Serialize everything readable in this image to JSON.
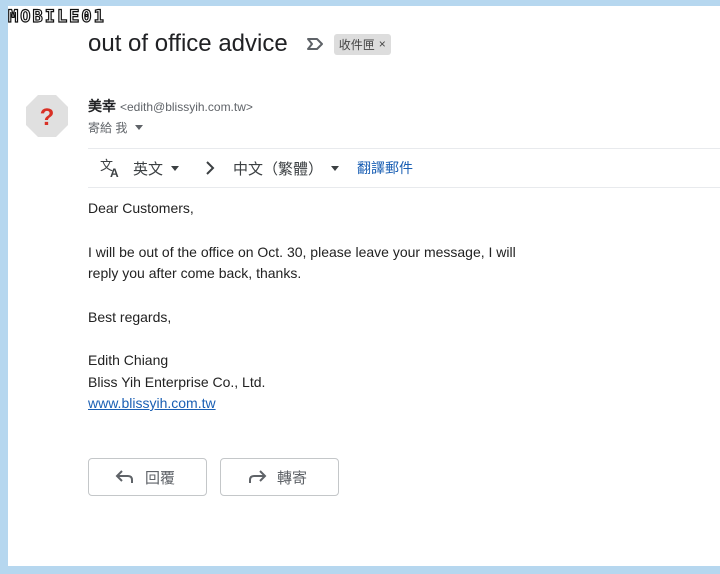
{
  "watermark": {
    "text": "MOBILE01"
  },
  "email": {
    "subject": "out of office advice",
    "label_chip": "收件匣",
    "label_close": "×",
    "sender_name": "美幸",
    "sender_email": "<edith@blissyih.com.tw>",
    "recipient_line": "寄給 我"
  },
  "translate": {
    "source_lang": "英文",
    "target_lang": "中文（繁體）",
    "translate_link": "翻譯郵件"
  },
  "body": {
    "greeting": "Dear Customers,",
    "line1": "I will be out of the office on Oct. 30, please leave your message, I will",
    "line2": "reply you after come back, thanks.",
    "closing": "Best regards,",
    "sig_name": "Edith Chiang",
    "sig_company": "Bliss Yih Enterprise Co., Ltd.",
    "sig_website": "www.blissyih.com.tw"
  },
  "actions": {
    "reply_label": "回覆",
    "forward_label": "轉寄"
  },
  "colors": {
    "frame_background": "#b6d7ef",
    "link_blue": "#1a5fb4",
    "avatar_red": "#d93025",
    "avatar_gray": "#e0e0e0"
  },
  "icons": [
    "mobile01-logo",
    "label-arrow-icon",
    "close-icon",
    "unknown-sender-icon",
    "chevron-down-icon",
    "translate-icon",
    "chevron-right-icon",
    "reply-icon",
    "forward-icon"
  ]
}
